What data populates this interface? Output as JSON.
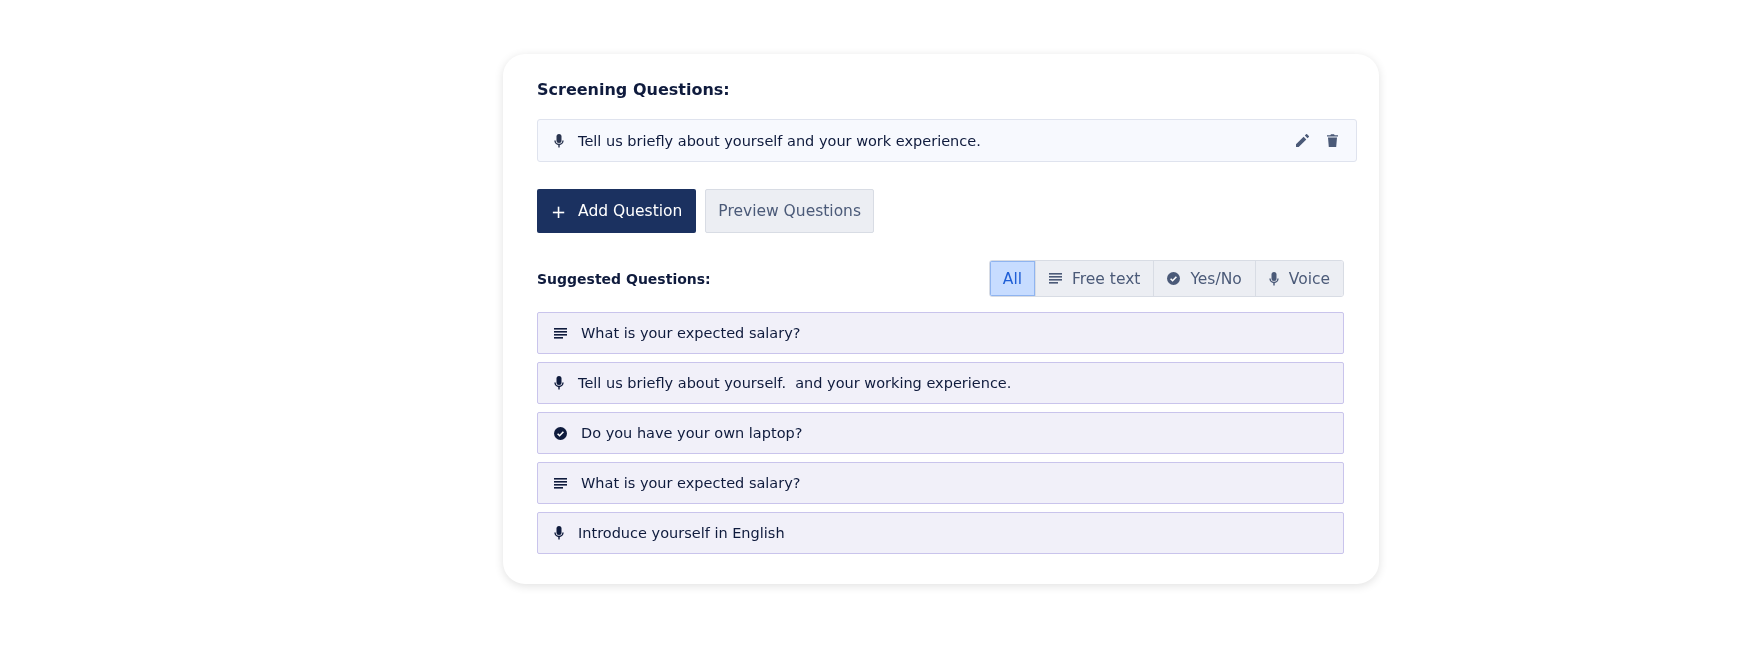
{
  "screening": {
    "title": "Screening Questions:",
    "questions": [
      {
        "kind": "voice",
        "text": "Tell us briefly about yourself and your work experience."
      }
    ]
  },
  "buttons": {
    "add": {
      "icon": "+",
      "label": "Add Question"
    },
    "preview": "Preview Questions"
  },
  "suggested": {
    "title": "Suggested Questions:",
    "filters": [
      {
        "kind": "all",
        "label": "All",
        "selected": true
      },
      {
        "kind": "text",
        "label": "Free text",
        "selected": false
      },
      {
        "kind": "yesno",
        "label": "Yes/No",
        "selected": false
      },
      {
        "kind": "voice",
        "label": "Voice",
        "selected": false
      }
    ],
    "questions": [
      {
        "kind": "text",
        "text": "What is your expected salary?"
      },
      {
        "kind": "voice",
        "text": "Tell us briefly about yourself.  and your working experience."
      },
      {
        "kind": "yesno",
        "text": "Do you have your own laptop?"
      },
      {
        "kind": "text",
        "text": "What is your expected salary?"
      },
      {
        "kind": "voice",
        "text": "Introduce yourself in English"
      }
    ]
  }
}
